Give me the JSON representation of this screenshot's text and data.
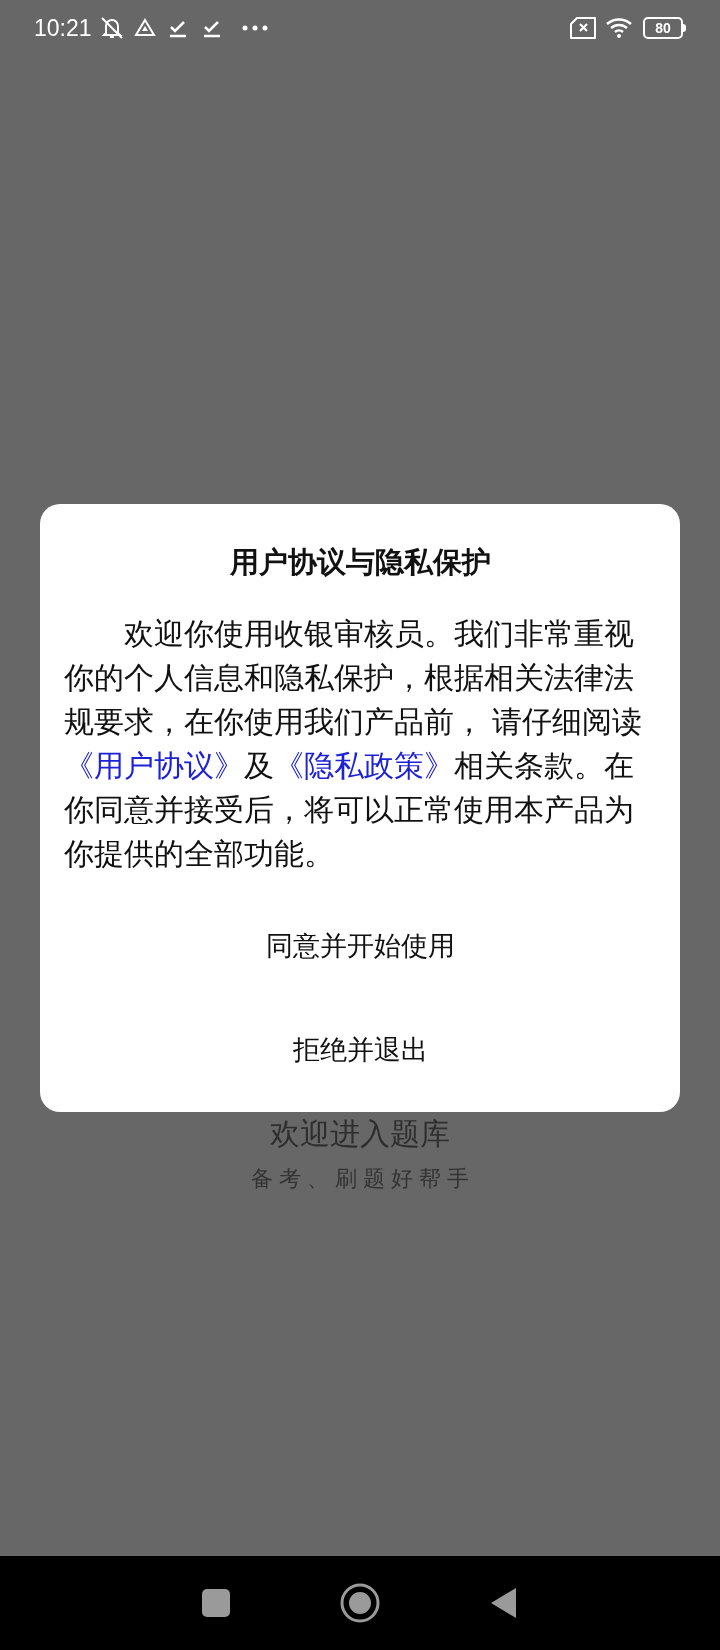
{
  "status_bar": {
    "time": "10:21",
    "battery": "80"
  },
  "background": {
    "title": "欢迎进入题库",
    "subtitle": "备 考 、 刷 题 好 帮 手"
  },
  "dialog": {
    "title": "用户协议与隐私保护",
    "body": [
      {
        "kind": "text",
        "text": "欢迎你使用收银审核员。我们非常重视你的个人信息和隐私保护，根据相关法律法规要求，在你使用我们产品前， 请仔细阅读"
      },
      {
        "kind": "link",
        "text": "《用户协议》"
      },
      {
        "kind": "text",
        "text": "及"
      },
      {
        "kind": "link",
        "text": "《隐私政策》"
      },
      {
        "kind": "text",
        "text": "相关条款。在你同意并接受后，将可以正常使用本产品为你提供的全部功能。"
      }
    ],
    "buttons": [
      "同意并开始使用",
      "拒绝并退出"
    ]
  }
}
